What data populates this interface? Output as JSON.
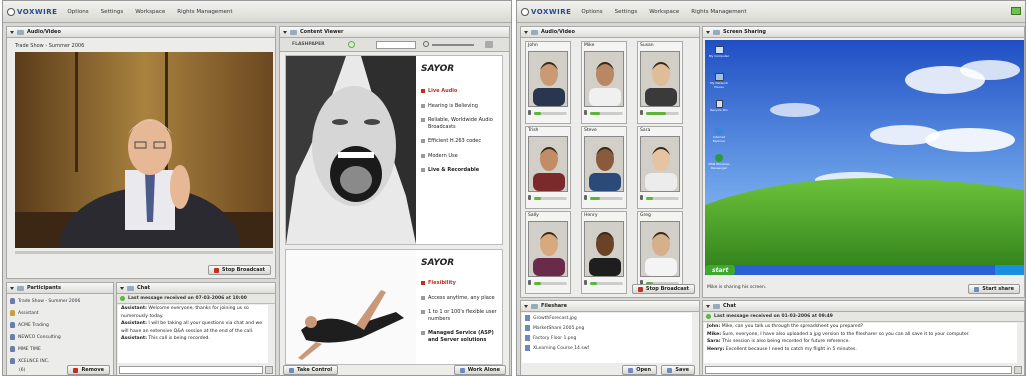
{
  "app": {
    "logo_text": "VOXWIRE",
    "menu": [
      "Options",
      "Settings",
      "Workspace",
      "Rights Management"
    ]
  },
  "left_screen": {
    "audio_video": {
      "title": "Audio/Video",
      "video_caption": "Trade Show - Summer 2006",
      "stop_broadcast_label": "Stop Broadcast"
    },
    "content_viewer": {
      "title": "Content Viewer",
      "toolbar_brand": "FLASHPAPER",
      "page1": {
        "brand": "SAYOR",
        "bullets": [
          {
            "text": "Live Audio",
            "highlight": true
          },
          {
            "text": "Hearing is Believing",
            "highlight": false
          },
          {
            "text": "Reliable, Worldwide Audio Broadcasts",
            "highlight": false
          },
          {
            "text": "Efficient H.263 codec",
            "highlight": false
          },
          {
            "text": "Modern Use",
            "highlight": false
          },
          {
            "text": "Live & Recordable",
            "highlight": false
          }
        ]
      },
      "page2": {
        "brand": "SAYOR",
        "bullets": [
          {
            "text": "Flexibility",
            "highlight": true
          },
          {
            "text": "Access anytime, any place",
            "highlight": false
          },
          {
            "text": "1 to 1 or 100's flexible user numbers",
            "highlight": false
          },
          {
            "text": "Managed Service (ASP) and Server solutions",
            "highlight": false
          }
        ]
      },
      "take_control_label": "Take Control",
      "work_alone_label": "Work Alone"
    },
    "participants": {
      "title": "Participants",
      "items": [
        "Trade Show - Summer 2006",
        "Assistant",
        "ACME Trading",
        "NEWCO Consulting",
        "MME TIME",
        "XCELNCE INC."
      ],
      "count_label": "(6)",
      "remove_label": "Remove"
    },
    "chat": {
      "title": "Chat",
      "last_message": "Last message received on 07-03-2006 at 10:00",
      "lines": [
        {
          "speaker": "Assistant:",
          "text": "Welcome everyone, thanks for joining us so numerously today."
        },
        {
          "speaker": "Assistant:",
          "text": "I will be taking all your questions via chat and we will have an extensive Q&A session at the end of the call."
        },
        {
          "speaker": "Assistant:",
          "text": "This call is being recorded."
        }
      ]
    }
  },
  "right_screen": {
    "audio_video": {
      "title": "Audio/Video",
      "participants": [
        {
          "name": "John",
          "level": 0.2
        },
        {
          "name": "Mike",
          "level": 0.3
        },
        {
          "name": "Susan",
          "level": 0.6
        },
        {
          "name": "Trish",
          "level": 0.2
        },
        {
          "name": "Steve",
          "level": 0.3
        },
        {
          "name": "Sara",
          "level": 0.2
        },
        {
          "name": "Sally",
          "level": 0.2
        },
        {
          "name": "Henry",
          "level": 0.2
        },
        {
          "name": "Greg",
          "level": 0.2
        }
      ],
      "stop_broadcast_label": "Stop Broadcast"
    },
    "screen_sharing": {
      "title": "Screen Sharing",
      "status": "Mike is sharing his screen.",
      "start_share_label": "Start share",
      "taskbar_start": "start",
      "desktop_icons": [
        "My Computer",
        "My Network Places",
        "Recycle Bin",
        "Internet Explorer",
        "MSN Windows Messenger"
      ]
    },
    "fileshare": {
      "title": "Fileshare",
      "files": [
        "GrowthForecast.jpg",
        "MarketShare 2005.png",
        "Factory Floor 1.png",
        "XLearning Course 14.swf"
      ],
      "open_label": "Open",
      "save_label": "Save"
    },
    "chat": {
      "title": "Chat",
      "last_message": "Last message received on 01-03-2006 at 09:49",
      "lines": [
        {
          "speaker": "John:",
          "text": "Mike, can you talk us through the spreadsheet you prepared?"
        },
        {
          "speaker": "Mike:",
          "text": "Sure, everyone, I have also uploaded a jpg version to the filesharer so you can all save it to your computer."
        },
        {
          "speaker": "Sara:",
          "text": "This session is also being recorded for future reference."
        },
        {
          "speaker": "Henry:",
          "text": "Excellent because I need to catch my flight in 5 minutes."
        }
      ]
    }
  },
  "colors": {
    "accent_green": "#5fb43c",
    "highlight_red": "#c0301f",
    "xp_blue": "#2a5fd6"
  }
}
